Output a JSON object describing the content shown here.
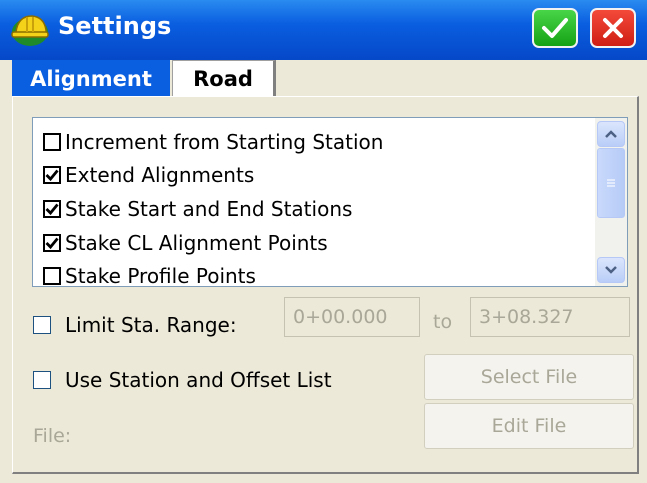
{
  "window": {
    "title": "Settings",
    "ok_icon": "checkmark-icon",
    "close_icon": "close-icon",
    "app_icon": "hardhat-icon",
    "colors": {
      "title_bar": "#0a5ee0",
      "ok": "#2dbd2d",
      "close": "#e33327"
    }
  },
  "tabs": [
    {
      "label": "Alignment",
      "active": true
    },
    {
      "label": "Road",
      "active": false
    }
  ],
  "stake_list": {
    "items": [
      {
        "label": "Increment from Starting Station",
        "checked": false
      },
      {
        "label": "Extend Alignments",
        "checked": true
      },
      {
        "label": "Stake Start and End Stations",
        "checked": true
      },
      {
        "label": "Stake CL Alignment Points",
        "checked": true
      },
      {
        "label": "Stake Profile Points",
        "checked": false
      }
    ]
  },
  "limit_range": {
    "label": "Limit Sta. Range:",
    "checked": false,
    "from_value": "0+00.000",
    "to_label": "to",
    "to_value": "3+08.327"
  },
  "station_list": {
    "label": "Use Station and Offset List",
    "checked": false,
    "select_file_label": "Select File",
    "edit_file_label": "Edit File",
    "file_label": "File:"
  }
}
